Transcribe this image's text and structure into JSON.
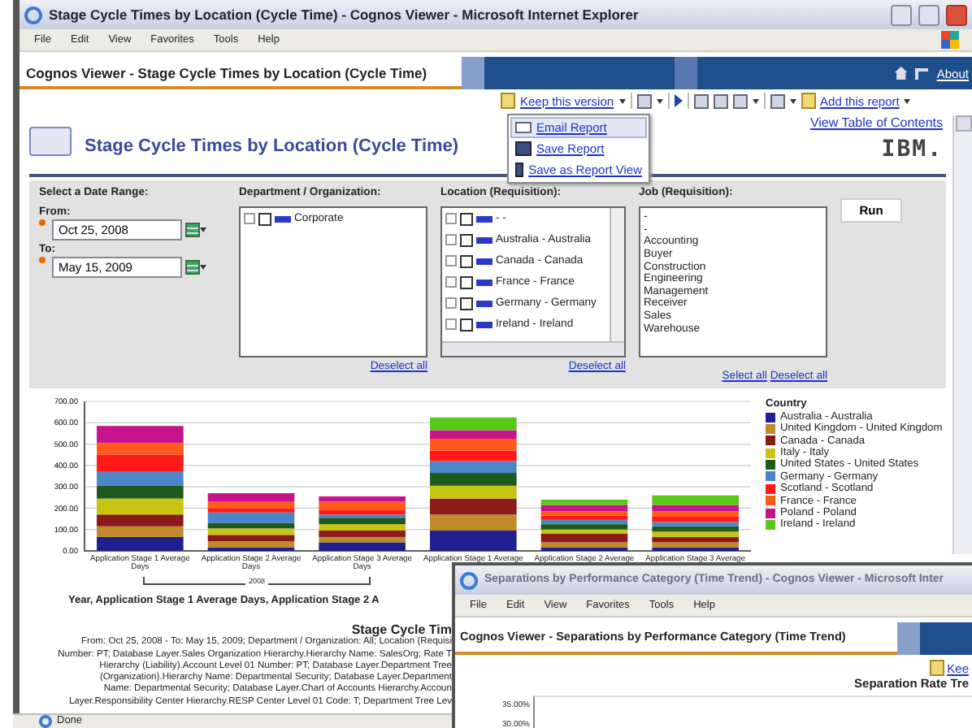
{
  "window": {
    "title": "Stage Cycle Times by Location (Cycle Time) - Cognos Viewer - Microsoft Internet Explorer"
  },
  "menu": [
    "File",
    "Edit",
    "View",
    "Favorites",
    "Tools",
    "Help"
  ],
  "viewer": {
    "title": "Cognos Viewer - Stage Cycle Times by Location (Cycle Time)",
    "about": "About"
  },
  "toolbar": {
    "keep_version": "Keep this version",
    "add_report": "Add this report"
  },
  "popup_menu": [
    {
      "label": "Email Report",
      "selected": true
    },
    {
      "label": "Save Report",
      "selected": false
    },
    {
      "label": "Save as Report View",
      "selected": false
    }
  ],
  "report": {
    "title": "Stage Cycle Times by Location (Cycle Time)",
    "toc_link": "View Table of Contents",
    "logo": "IBM."
  },
  "prompts": {
    "date_heading": "Select a Date Range:",
    "from_label": "From:",
    "from_value": "Oct 25, 2008",
    "to_label": "To:",
    "to_value": "May 15, 2009",
    "department": {
      "heading": "Department / Organization:",
      "items": [
        {
          "label": "Corporate",
          "checked": false
        }
      ],
      "deselect": "Deselect all"
    },
    "location": {
      "heading": "Location (Requisition):",
      "items": [
        {
          "label": "- -",
          "checked": false
        },
        {
          "label": "Australia - Australia",
          "checked": false
        },
        {
          "label": "Canada - Canada",
          "checked": false
        },
        {
          "label": "France - France",
          "checked": false
        },
        {
          "label": "Germany - Germany",
          "checked": false
        },
        {
          "label": "Ireland - Ireland",
          "checked": false
        }
      ],
      "deselect": "Deselect all"
    },
    "job": {
      "heading": "Job (Requisition):",
      "options": [
        "-",
        "-",
        "Accounting",
        "Buyer",
        "Construction",
        "Engineering",
        "Management",
        "Receiver",
        "Sales",
        "Warehouse"
      ],
      "select_all": "Select all",
      "deselect": "Deselect all"
    },
    "run": "Run"
  },
  "chart": {
    "legend_title": "Country",
    "group_label": "2008",
    "axis_title": "Year, Application Stage 1 Average Days, Application Stage 2 A",
    "chart_data": {
      "type": "bar",
      "stacked": true,
      "grid": true,
      "categories": [
        "Application Stage 1 Average Days",
        "Application Stage 2 Average Days",
        "Application Stage 3 Average Days",
        "Application Stage 1 Average",
        "Application Stage 2 Average",
        "Application Stage 3 Average"
      ],
      "ylim": [
        0,
        700
      ],
      "yticks": [
        {
          "value": 0,
          "label": "0.00"
        },
        {
          "value": 100,
          "label": "100.00"
        },
        {
          "value": 200,
          "label": "200.00"
        },
        {
          "value": 300,
          "label": "300.00"
        },
        {
          "value": 400,
          "label": "400.00"
        },
        {
          "value": 500,
          "label": "500.00"
        },
        {
          "value": 600,
          "label": "600.00"
        },
        {
          "value": 700,
          "label": "700.00"
        }
      ],
      "series": [
        {
          "name": "Australia - Australia",
          "color": "#1f1f8f",
          "values": [
            65,
            15,
            40,
            95,
            15,
            15
          ]
        },
        {
          "name": "United Kingdom - United Kingdom",
          "color": "#c08a2a",
          "values": [
            50,
            30,
            25,
            75,
            25,
            25
          ]
        },
        {
          "name": "Canada - Canada",
          "color": "#8b1a1a",
          "values": [
            55,
            30,
            30,
            75,
            40,
            25
          ]
        },
        {
          "name": "Italy - Italy",
          "color": "#c8c414",
          "values": [
            75,
            30,
            30,
            60,
            20,
            25
          ]
        },
        {
          "name": "United States - United States",
          "color": "#1e5a1e",
          "values": [
            60,
            25,
            30,
            60,
            25,
            25
          ]
        },
        {
          "name": "Germany - Germany",
          "color": "#4a86c8",
          "values": [
            65,
            50,
            15,
            55,
            20,
            20
          ]
        },
        {
          "name": "Scotland - Scotland",
          "color": "#ff1a1a",
          "values": [
            80,
            20,
            20,
            50,
            20,
            25
          ]
        },
        {
          "name": "France - France",
          "color": "#ff5a1a",
          "values": [
            55,
            30,
            40,
            55,
            20,
            25
          ]
        },
        {
          "name": "Poland - Poland",
          "color": "#c8148c",
          "values": [
            80,
            40,
            25,
            40,
            30,
            30
          ]
        },
        {
          "name": "Ireland - Ireland",
          "color": "#5ac81a",
          "values": [
            0,
            0,
            0,
            60,
            25,
            45
          ]
        }
      ]
    }
  },
  "summary": {
    "title": "Stage Cycle Tim",
    "lines": [
      "From: Oct 25, 2008 - To: May 15, 2009; Department / Organization: All; Location (Requisi",
      "Number: PT; Database Layer.Sales Organization Hierarchy.Hierarchy Name: SalesOrg; Rate T",
      "Hierarchy (Liability).Account Level 01 Number: PT; Database Layer.Department Tree",
      "(Organization).Hierarchy Name: Departmental Security; Database Layer.Department",
      "Name: Departmental Security; Database Layer.Chart of Accounts Hierarchy.Accoun",
      "Layer.Responsibility Center Hierarchy.RESP Center Level 01 Code: T; Department Tree Lev"
    ]
  },
  "status_bar": "Done",
  "second_window": {
    "title": "Separations by Performance Category (Time Trend) - Cognos Viewer - Microsoft Inter",
    "menu": [
      "File",
      "Edit",
      "View",
      "Favorites",
      "Tools",
      "Help"
    ],
    "viewer_title": "Cognos Viewer - Separations by Performance Category (Time Trend)",
    "keep_link": "Kee",
    "report_title": "Separation Rate Tre",
    "yticks": [
      "35.00%",
      "30.00%"
    ]
  }
}
